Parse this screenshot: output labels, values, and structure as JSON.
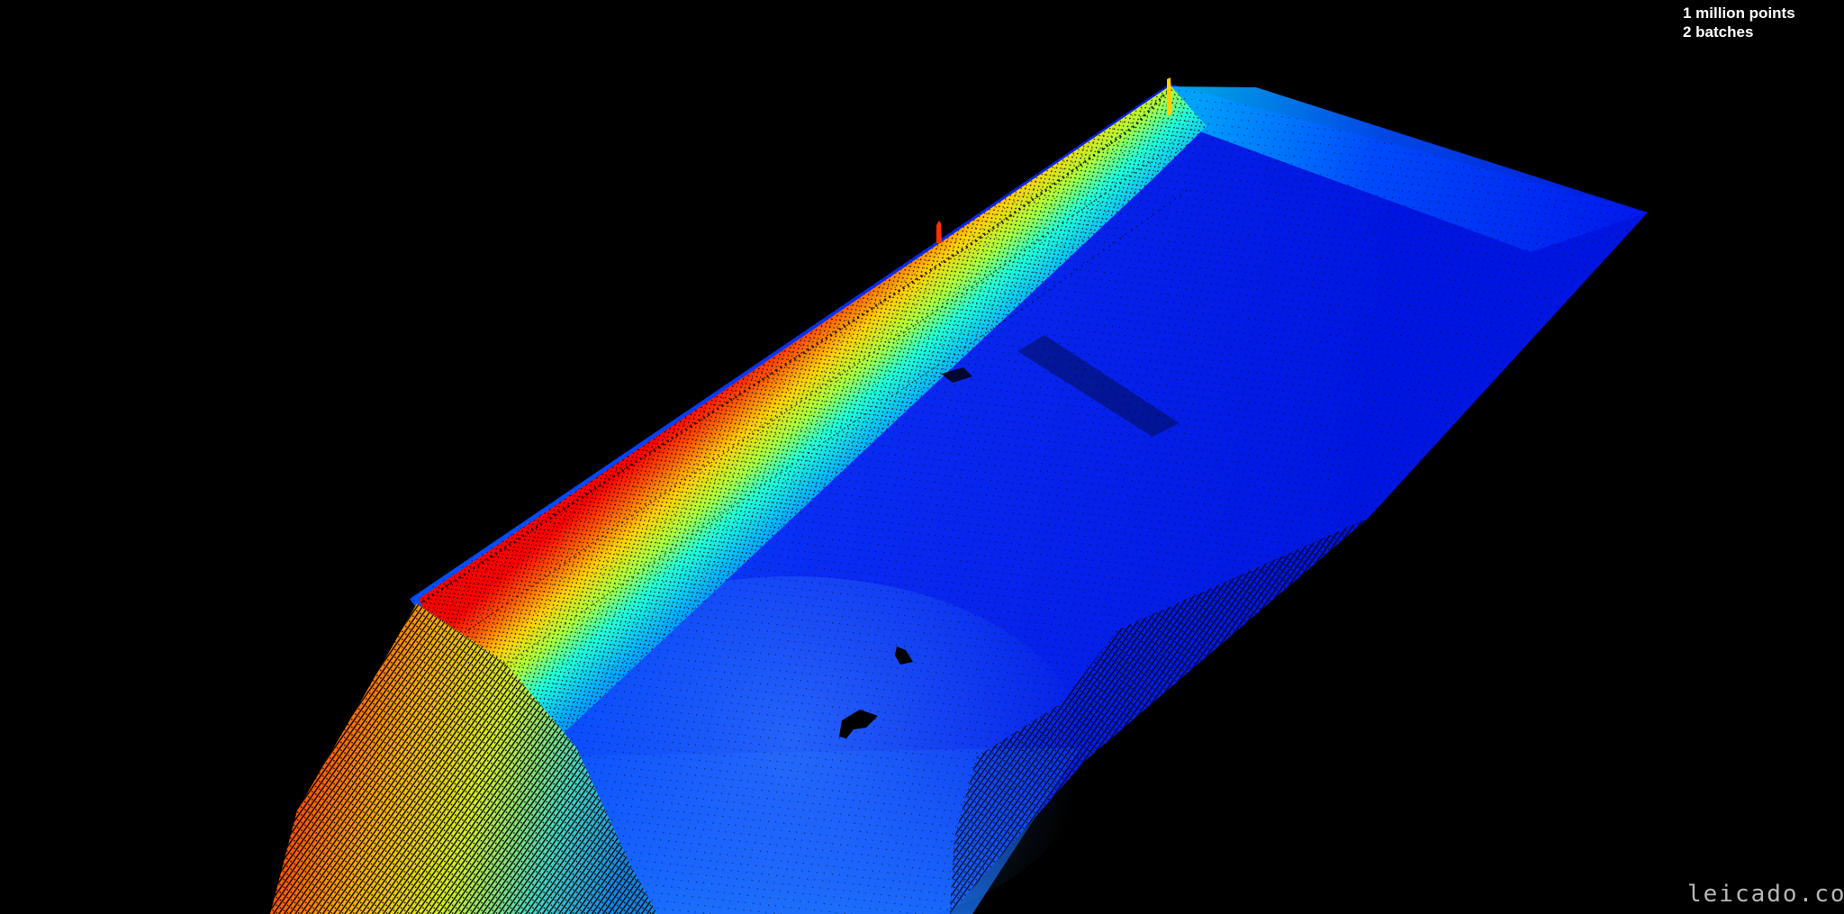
{
  "overlay": {
    "points_label": "1 million points",
    "batches_label": "2 batches",
    "text_color": "#ffffff"
  },
  "watermark": {
    "text": "leicado.com",
    "color": "#d8d8d8"
  },
  "scene": {
    "background_color": "#000000",
    "colormap": [
      "#00008f",
      "#0000ff",
      "#0080ff",
      "#00ffff",
      "#80ff80",
      "#ffff00",
      "#ff8000",
      "#ff0000"
    ]
  }
}
